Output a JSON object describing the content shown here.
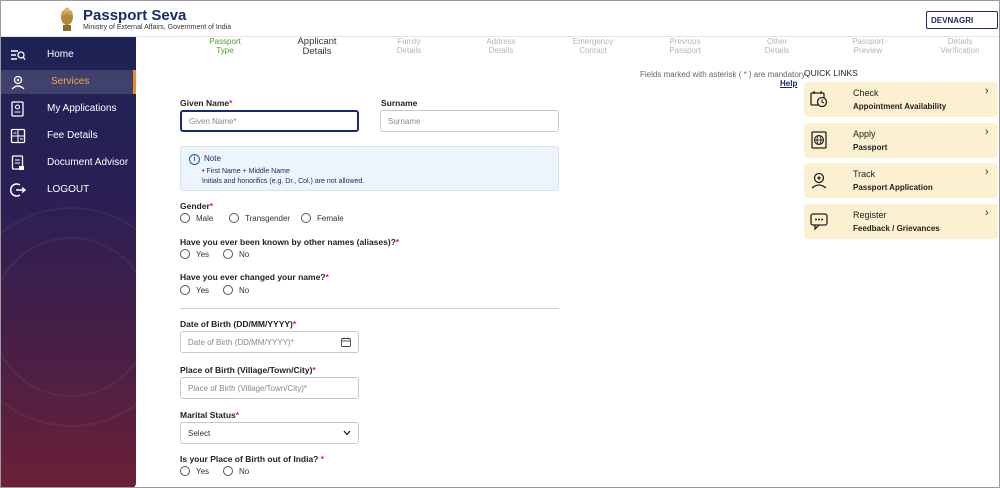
{
  "header": {
    "title": "Passport Seva",
    "subtitle": "Ministry of External Affairs, Government of India",
    "language": "DEVNAGRI"
  },
  "sidebar": {
    "items": [
      {
        "label": "Home",
        "icon": "home-search-icon"
      },
      {
        "label": "Services",
        "icon": "services-icon",
        "active": true
      },
      {
        "label": "My Applications",
        "icon": "applications-icon"
      },
      {
        "label": "Fee Details",
        "icon": "calculator-icon"
      },
      {
        "label": "Document Advisor",
        "icon": "document-icon"
      },
      {
        "label": "LOGOUT",
        "icon": "logout-icon"
      }
    ]
  },
  "stepper": {
    "steps": [
      {
        "line1": "Passport",
        "line2": "Type",
        "state": "done"
      },
      {
        "line1": "Applicant",
        "line2": "Details",
        "state": "current"
      },
      {
        "line1": "Family",
        "line2": "Details",
        "state": "pending"
      },
      {
        "line1": "Address",
        "line2": "Details",
        "state": "pending"
      },
      {
        "line1": "Emergency",
        "line2": "Contact",
        "state": "pending"
      },
      {
        "line1": "Previous",
        "line2": "Passport",
        "state": "pending"
      },
      {
        "line1": "Other",
        "line2": "Details",
        "state": "pending"
      },
      {
        "line1": "Passport",
        "line2": "Preview",
        "state": "pending"
      },
      {
        "line1": "Details",
        "line2": "Verification",
        "state": "pending"
      }
    ]
  },
  "form": {
    "mandatory_note": "Fields marked with asterisk ( * ) are mandatory",
    "help": "Help",
    "required_mark": "*",
    "given_name": {
      "label": "Given Name",
      "placeholder": "Given Name*"
    },
    "surname": {
      "label": "Surname",
      "placeholder": "Surname"
    },
    "note": {
      "title": "Note",
      "line1": "First Name + Middle Name",
      "line2": "Initials and honorifics (e.g. Dr., Col.) are not allowed."
    },
    "gender": {
      "label": "Gender",
      "options": [
        "Male",
        "Transgender",
        "Female"
      ]
    },
    "aliases": {
      "label": "Have you ever been known by other names (aliases)?",
      "options": [
        "Yes",
        "No"
      ]
    },
    "changed_name": {
      "label": "Have you ever changed your name?",
      "options": [
        "Yes",
        "No"
      ]
    },
    "dob": {
      "label": "Date of Birth (DD/MM/YYYY)",
      "placeholder": "Date of Birth (DD/MM/YYYY)*"
    },
    "pob": {
      "label": "Place of Birth (Village/Town/City)",
      "placeholder": "Place of Birth (Village/Town/City)*"
    },
    "marital": {
      "label": "Marital Status",
      "selected": "Select"
    },
    "pob_outside": {
      "label": "Is your Place of Birth out of India? ",
      "options": [
        "Yes",
        "No"
      ]
    }
  },
  "quick_links": {
    "title": "QUICK LINKS",
    "cards": [
      {
        "t1": "Check",
        "t2": "Appointment Availability",
        "icon": "calendar-clock-icon"
      },
      {
        "t1": "Apply",
        "t2": "Passport",
        "icon": "passport-globe-icon"
      },
      {
        "t1": "Track",
        "t2": "Passport Application",
        "icon": "track-icon"
      },
      {
        "t1": "Register",
        "t2": "Feedback / Grievances",
        "icon": "feedback-icon"
      }
    ]
  },
  "colors": {
    "brand": "#1b2a6b",
    "accent": "#e98d2b",
    "quick_link_bg": "#fbf0cf",
    "done_step": "#4f9a3a"
  }
}
